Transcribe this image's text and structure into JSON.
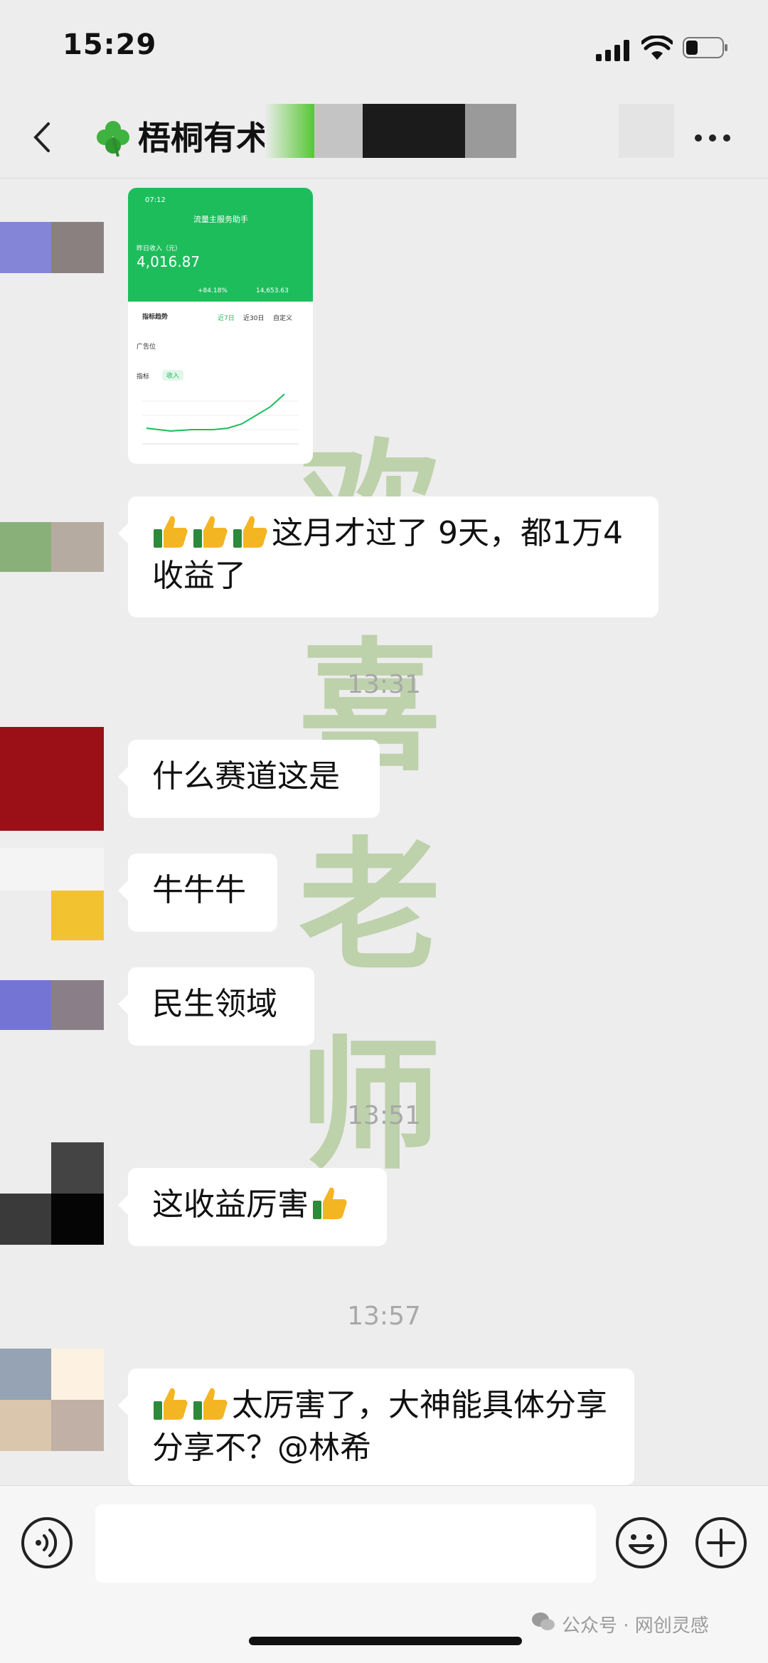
{
  "status_bar": {
    "time": "15:29"
  },
  "nav": {
    "title": "梧桐有术"
  },
  "messages": [
    {
      "type": "image",
      "screenshot": {
        "clock": "07:12",
        "app_title": "流量主服务助手",
        "label": "昨日收入（元）",
        "value": "4,016.87",
        "stat1": "+84.18%",
        "stat2": "14,653.63",
        "section": "指标趋势",
        "tabs": [
          "近7日",
          "近30日",
          "自定义"
        ],
        "filter_label": "广告位",
        "metric_label": "指标",
        "metric": "收入"
      }
    },
    {
      "type": "text",
      "thumbs": 3,
      "text": "这月才过了 9天，都1万4收益了"
    },
    {
      "type": "time",
      "text": "13:31"
    },
    {
      "type": "text",
      "thumbs": 0,
      "text": "什么赛道这是"
    },
    {
      "type": "text",
      "thumbs": 0,
      "text": "牛牛牛"
    },
    {
      "type": "text",
      "thumbs": 0,
      "text": "民生领域"
    },
    {
      "type": "time",
      "text": "13:51"
    },
    {
      "type": "text",
      "thumbs": 0,
      "text": "这收益厉害",
      "trailing_thumbs": 1
    },
    {
      "type": "time",
      "text": "13:57"
    },
    {
      "type": "text",
      "thumbs": 2,
      "text": "太厉害了，大神能具体分享分享不？@林希"
    }
  ],
  "watermark": [
    "欢",
    "喜",
    "老",
    "师"
  ],
  "footer": {
    "credit": "公众号 · 网创灵感"
  },
  "icons": {
    "back": "chevron-left-icon",
    "more": "more-icon",
    "voice": "voice-icon",
    "emoji": "emoji-icon",
    "plus": "plus-icon",
    "thumbs": "thumbs-up-icon"
  },
  "colors": {
    "bg": "#ededed",
    "bubble": "#ffffff",
    "accent": "#1ebd5c"
  }
}
